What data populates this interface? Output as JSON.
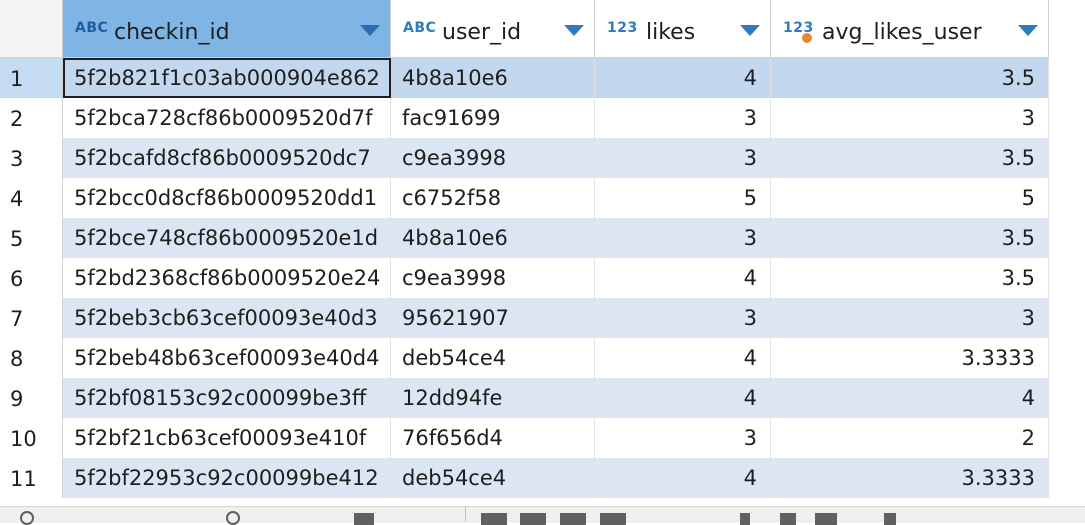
{
  "columns": [
    {
      "type": "ABC",
      "name": "checkin_id",
      "selected": true
    },
    {
      "type": "ABC",
      "name": "user_id",
      "selected": false
    },
    {
      "type": "123",
      "name": "likes",
      "selected": false
    },
    {
      "type": "123",
      "name": "avg_likes_user",
      "selected": false,
      "computed": true
    }
  ],
  "rows": [
    {
      "n": "1",
      "checkin_id": "5f2b821f1c03ab000904e862",
      "user_id": "4b8a10e6",
      "likes": "4",
      "avg": "3.5"
    },
    {
      "n": "2",
      "checkin_id": "5f2bca728cf86b0009520d7f",
      "user_id": "fac91699",
      "likes": "3",
      "avg": "3"
    },
    {
      "n": "3",
      "checkin_id": "5f2bcafd8cf86b0009520dc7",
      "user_id": "c9ea3998",
      "likes": "3",
      "avg": "3.5"
    },
    {
      "n": "4",
      "checkin_id": "5f2bcc0d8cf86b0009520dd1",
      "user_id": "c6752f58",
      "likes": "5",
      "avg": "5"
    },
    {
      "n": "5",
      "checkin_id": "5f2bce748cf86b0009520e1d",
      "user_id": "4b8a10e6",
      "likes": "3",
      "avg": "3.5"
    },
    {
      "n": "6",
      "checkin_id": "5f2bd2368cf86b0009520e24",
      "user_id": "c9ea3998",
      "likes": "4",
      "avg": "3.5"
    },
    {
      "n": "7",
      "checkin_id": "5f2beb3cb63cef00093e40d3",
      "user_id": "95621907",
      "likes": "3",
      "avg": "3"
    },
    {
      "n": "8",
      "checkin_id": "5f2beb48b63cef00093e40d4",
      "user_id": "deb54ce4",
      "likes": "4",
      "avg": "3.3333"
    },
    {
      "n": "9",
      "checkin_id": "5f2bf08153c92c00099be3ff",
      "user_id": "12dd94fe",
      "likes": "4",
      "avg": "4"
    },
    {
      "n": "10",
      "checkin_id": "5f2bf21cb63cef00093e410f",
      "user_id": "76f656d4",
      "likes": "3",
      "avg": "2"
    },
    {
      "n": "11",
      "checkin_id": "5f2bf22953c92c00099be412",
      "user_id": "deb54ce4",
      "likes": "4",
      "avg": "3.3333"
    }
  ],
  "colors": {
    "accent": "#2f7bc0",
    "selected_header": "#7fb5e4",
    "stripe": "#dce6f2",
    "computed_dot": "#e78a2d"
  }
}
